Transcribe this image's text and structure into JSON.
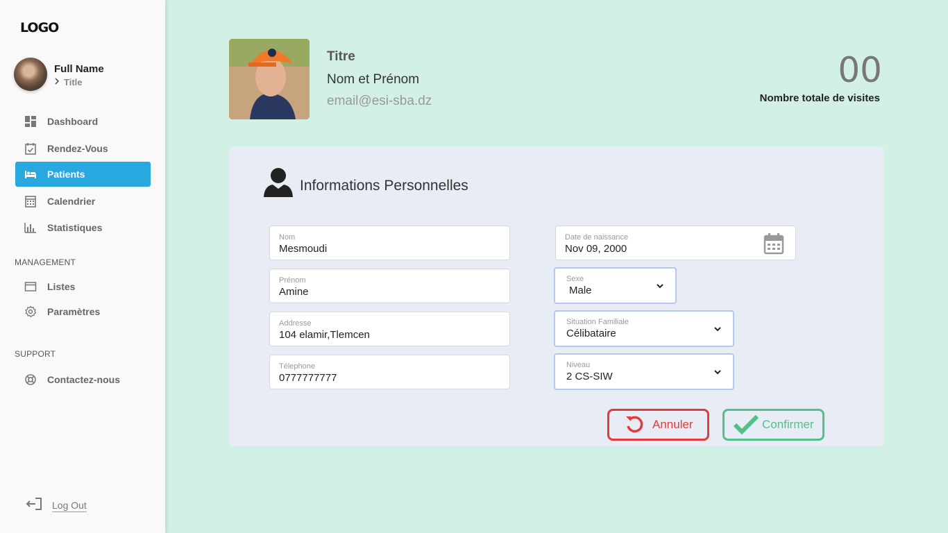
{
  "sidebar": {
    "logo": "LOGO",
    "profile": {
      "name": "Full Name",
      "title": "Title"
    },
    "nav": [
      {
        "label": "Dashboard",
        "icon": "dashboard-icon"
      },
      {
        "label": "Rendez-Vous",
        "icon": "calendar-check-icon"
      },
      {
        "label": "Patients",
        "icon": "bed-icon",
        "active": true
      },
      {
        "label": "Calendrier",
        "icon": "calendar-grid-icon"
      },
      {
        "label": "Statistiques",
        "icon": "bar-chart-icon"
      }
    ],
    "management_label": "MANAGEMENT",
    "management": [
      {
        "label": "Listes",
        "icon": "window-icon"
      },
      {
        "label": "Paramètres",
        "icon": "gear-icon"
      }
    ],
    "support_label": "SUPPORT",
    "support": [
      {
        "label": "Contactez-nous",
        "icon": "lifebuoy-icon"
      }
    ],
    "logout": "Log Out"
  },
  "header": {
    "titre": "Titre",
    "nom_prenom": "Nom et Prénom",
    "email": "email@esi-sba.dz",
    "visits_count": "00",
    "visits_label": "Nombre totale de visites"
  },
  "form": {
    "title": "Informations Personnelles",
    "nom": {
      "label": "Nom",
      "value": "Mesmoudi"
    },
    "prenom": {
      "label": "Prénom",
      "value": "Amine"
    },
    "adresse": {
      "label": "Addresse",
      "value": "104 elamir,Tlemcen"
    },
    "telephone": {
      "label": "Télephone",
      "value": "0777777777"
    },
    "date_naissance": {
      "label": "Date de naissance",
      "value": "Nov 09, 2000"
    },
    "sexe": {
      "label": "Sexe",
      "value": "Male"
    },
    "situation": {
      "label": "Situation Familiale",
      "value": "Célibataire"
    },
    "niveau": {
      "label": "Niveau",
      "value": "2 CS-SIW"
    },
    "cancel_label": "Annuler",
    "confirm_label": "Confirmer"
  },
  "colors": {
    "background": "#d2f0e6",
    "active_nav": "#29a8e0",
    "cancel": "#e23b3b",
    "confirm": "#52c08a"
  }
}
